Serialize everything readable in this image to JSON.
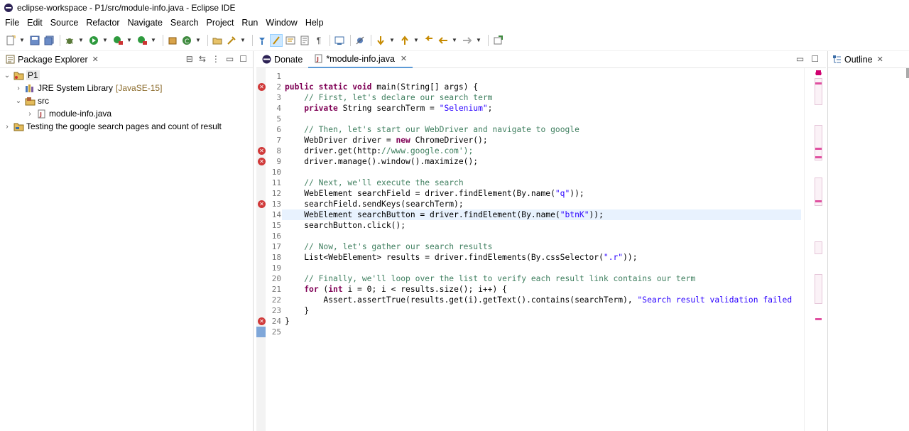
{
  "window": {
    "title": "eclipse-workspace - P1/src/module-info.java - Eclipse IDE"
  },
  "menu": [
    "File",
    "Edit",
    "Source",
    "Refactor",
    "Navigate",
    "Search",
    "Project",
    "Run",
    "Window",
    "Help"
  ],
  "package_explorer": {
    "title": "Package Explorer",
    "tree": [
      {
        "label": "P1",
        "decor": "",
        "level": 0,
        "expanded": true,
        "icon": "project-icon"
      },
      {
        "label": "JRE System Library",
        "decor": "[JavaSE-15]",
        "level": 1,
        "expanded": false,
        "icon": "library-icon"
      },
      {
        "label": "src",
        "decor": "",
        "level": 1,
        "expanded": true,
        "icon": "package-folder-icon"
      },
      {
        "label": "module-info.java",
        "decor": "",
        "level": 2,
        "expanded": false,
        "icon": "java-file-icon"
      },
      {
        "label": "Testing the google search pages and count of result",
        "decor": "",
        "level": 0,
        "expanded": false,
        "icon": "project-icon"
      }
    ]
  },
  "editor": {
    "tabs": [
      {
        "label": "Donate",
        "active": false,
        "icon": "eclipse-icon"
      },
      {
        "label": "*module-info.java",
        "active": true,
        "icon": "java-file-icon"
      }
    ],
    "error_lines": [
      2,
      8,
      9,
      13,
      24
    ],
    "current_line": 14,
    "lines": [
      "",
      "public static void main(String[] args) {",
      "    // First, let's declare our search term",
      "    private String searchTerm = \"Selenium\";",
      "",
      "    // Then, let's start our WebDriver and navigate to google",
      "    WebDriver driver = new ChromeDriver();",
      "    driver.get('http://www.google.com');",
      "    driver.manage().window().maximize();",
      "",
      "    // Next, we'll execute the search",
      "    WebElement searchField = driver.findElement(By.name(\"q\"));",
      "    searchField.sendKeys(searchTerm);",
      "    WebElement searchButton = driver.findElement(By.name(\"btnK\"));",
      "    searchButton.click();",
      "",
      "    // Now, let's gather our search results",
      "    List<WebElement> results = driver.findElements(By.cssSelector(\".r\"));",
      "",
      "    // Finally, we'll loop over the list to verify each result link contains our term",
      "    for (int i = 0; i < results.size(); i++) {",
      "        Assert.assertTrue(results.get(i).getText().contains(searchTerm), \"Search result validation failed",
      "    }",
      "}",
      ""
    ]
  },
  "outline": {
    "title": "Outline"
  },
  "colors": {
    "keyword": "#7f0055",
    "comment": "#3f7f5f",
    "string": "#2a00ff",
    "error": "#d03a3a",
    "current_line": "#e8f2fe"
  }
}
